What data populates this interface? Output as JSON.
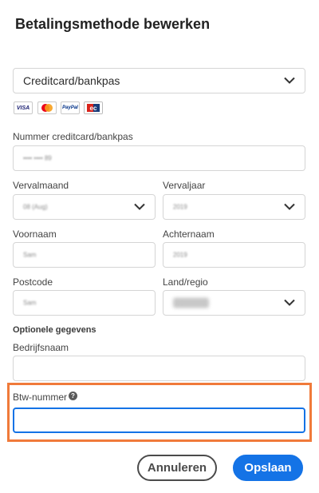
{
  "dialog": {
    "title": "Betalingsmethode bewerken"
  },
  "payment_method": {
    "selected": "Creditcard/bankpas"
  },
  "card_icons": [
    "visa-icon",
    "mastercard-icon",
    "paypal-icon",
    "ec-card-icon"
  ],
  "card_icon_text": {
    "visa": "VISA",
    "paypal": "PayPal"
  },
  "fields": {
    "card_number_label": "Nummer creditcard/bankpas",
    "card_number_value": "•••• •••• 89",
    "exp_month_label": "Vervalmaand",
    "exp_month_value": "08 (Aug)",
    "exp_year_label": "Vervaljaar",
    "exp_year_value": "2019",
    "first_name_label": "Voornaam",
    "first_name_value": "Sam",
    "last_name_label": "Achternaam",
    "last_name_value": "2019",
    "postcode_label": "Postcode",
    "postcode_value": "Sam",
    "country_label": "Land/regio",
    "country_value": "Nederland",
    "optional_heading": "Optionele gegevens",
    "company_label": "Bedrijfsnaam",
    "vat_label": "Btw-nummer"
  },
  "buttons": {
    "cancel": "Annuleren",
    "save": "Opslaan"
  },
  "colors": {
    "accent": "#1473e6",
    "highlight": "#f07a3a"
  }
}
